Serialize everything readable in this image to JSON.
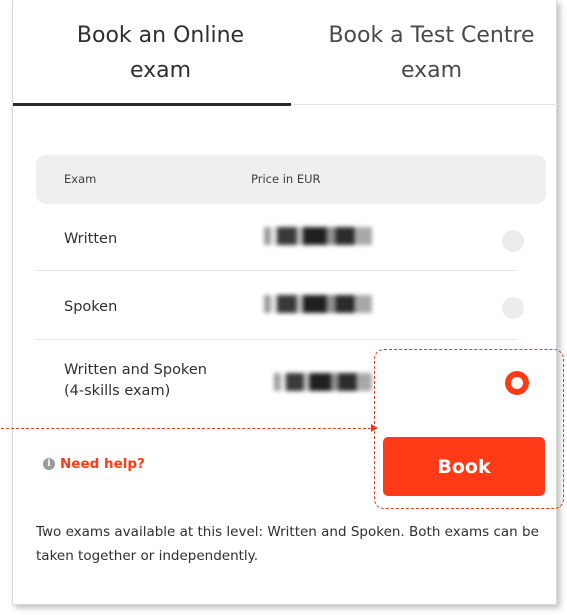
{
  "tabs": [
    {
      "line1": "Book an Online",
      "line2": "exam",
      "active": true
    },
    {
      "line1": "Book a Test Centre",
      "line2": "exam",
      "active": false
    }
  ],
  "table": {
    "headers": {
      "exam": "Exam",
      "price": "Price in EUR"
    },
    "rows": [
      {
        "label_line1": "Written",
        "label_line2": "",
        "price": "redacted",
        "selected": false
      },
      {
        "label_line1": "Spoken",
        "label_line2": "",
        "price": "redacted",
        "selected": false
      },
      {
        "label_line1": "Written and Spoken",
        "label_line2": "(4-skills exam)",
        "price": "redacted",
        "selected": true
      }
    ]
  },
  "help": {
    "label": "Need help?",
    "icon": "info-icon"
  },
  "book_button": {
    "label": "Book"
  },
  "note": "Two exams available at this level: Written and Spoken. Both exams can be taken together or independently.",
  "colors": {
    "accent": "#ff3b17",
    "annotation": "#d9401e",
    "header_bg": "#efefef",
    "text": "#2f2f2f"
  }
}
